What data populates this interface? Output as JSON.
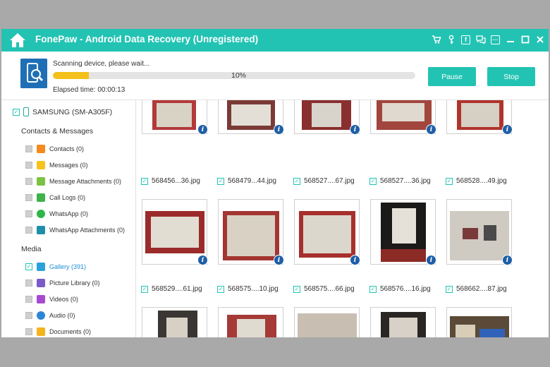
{
  "window": {
    "title": "FonePaw - Android Data Recovery (Unregistered)",
    "accent_color": "#22c3b3",
    "titlebar_icons": [
      "cart-icon",
      "key-icon",
      "facebook-icon",
      "feedback-icon",
      "menu-icon",
      "minimize-icon",
      "maximize-icon",
      "close-icon"
    ]
  },
  "scan": {
    "status": "Scanning device, please wait...",
    "progress_label": "10%",
    "progress_value": 0.1,
    "elapsed": "Elapsed time: 00:00:13",
    "pause_label": "Pause",
    "stop_label": "Stop"
  },
  "sidebar": {
    "device": "SAMSUNG (SM-A305F)",
    "contacts_heading": "Contacts & Messages",
    "contacts_items": [
      {
        "label": "Contacts (0)",
        "icon": "contacts-icon",
        "color": "#f58a1f"
      },
      {
        "label": "Messages (0)",
        "icon": "messages-icon",
        "color": "#f7c21b"
      },
      {
        "label": "Message Attachments (0)",
        "icon": "attachment-icon",
        "color": "#7cc242"
      },
      {
        "label": "Call Logs (0)",
        "icon": "phone-icon",
        "color": "#3db34a"
      },
      {
        "label": "WhatsApp (0)",
        "icon": "whatsapp-icon",
        "color": "#2fb54a"
      },
      {
        "label": "WhatsApp Attachments (0)",
        "icon": "whatsapp-attachment-icon",
        "color": "#1e8fa8"
      }
    ],
    "media_heading": "Media",
    "media_items": [
      {
        "label": "Gallery (391)",
        "icon": "gallery-icon",
        "color": "#2aa1dc",
        "checked": true
      },
      {
        "label": "Picture Library (0)",
        "icon": "picture-library-icon",
        "color": "#7b5bc9",
        "checked": false
      },
      {
        "label": "Videos (0)",
        "icon": "videos-icon",
        "color": "#a64bd0",
        "checked": false
      },
      {
        "label": "Audio (0)",
        "icon": "audio-icon",
        "color": "#2c84d6",
        "checked": false
      },
      {
        "label": "Documents (0)",
        "icon": "documents-icon",
        "color": "#f5b31c",
        "checked": false
      }
    ]
  },
  "gallery": {
    "row1_captions": [
      "568456...36.jpg",
      "568479...44.jpg",
      "568527....67.jpg",
      "568527....36.jpg",
      "568528....49.jpg"
    ],
    "row2_captions": [
      "568529....61.jpg",
      "568575....10.jpg",
      "568575....66.jpg",
      "568576....16.jpg",
      "568662....87.jpg"
    ]
  }
}
